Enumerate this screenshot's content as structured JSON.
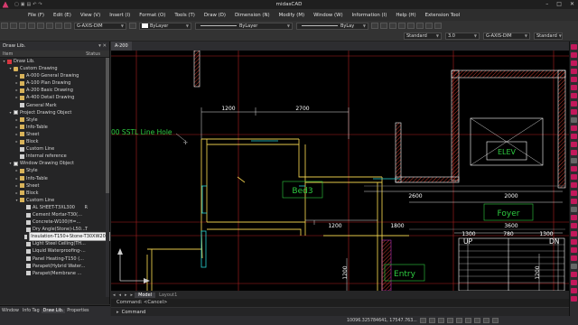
{
  "app": {
    "title": "midasCAD"
  },
  "menu": [
    "File (F)",
    "Edit (E)",
    "View (V)",
    "Insert (I)",
    "Format (O)",
    "Tools (T)",
    "Draw (D)",
    "Dimension (N)",
    "Modify (M)",
    "Window (W)",
    "Information (I)",
    "Help (H)",
    "Extension Tool"
  ],
  "toolbar": {
    "layer": "G-AXIS-DIM",
    "color": "ByLayer",
    "linetype": "ByLayer",
    "lineweight": "ByLay",
    "text_style": "Standard",
    "text_height": "3.0",
    "dim_layer": "G-AXIS-DIM",
    "dim_style": "Standard"
  },
  "left_panel": {
    "title": "Draw Lib.",
    "col_item": "Item",
    "col_status": "Status",
    "tree": [
      {
        "label": "Draw Lib.",
        "depth": 0,
        "icon": "red",
        "exp": "▾"
      },
      {
        "label": "Custom Drawing",
        "depth": 1,
        "icon": "cube",
        "exp": "▾"
      },
      {
        "label": "A-000 General Drawing",
        "depth": 2,
        "icon": "folder",
        "exp": "▸"
      },
      {
        "label": "A-100 Plan Drawing",
        "depth": 2,
        "icon": "folder",
        "exp": "▸"
      },
      {
        "label": "A-200 Basic Drawing",
        "depth": 2,
        "icon": "folder",
        "exp": "▸"
      },
      {
        "label": "A-400 Detail Drawing",
        "depth": 2,
        "icon": "folder",
        "exp": "▸"
      },
      {
        "label": "General Mark",
        "depth": 2,
        "icon": "doc",
        "exp": ""
      },
      {
        "label": "Project Drawing Object",
        "depth": 1,
        "icon": "chk",
        "exp": "▾"
      },
      {
        "label": "Style",
        "depth": 2,
        "icon": "folder",
        "exp": "▸"
      },
      {
        "label": "Info-Table",
        "depth": 2,
        "icon": "folder",
        "exp": "▸"
      },
      {
        "label": "Sheet",
        "depth": 2,
        "icon": "folder",
        "exp": "▸"
      },
      {
        "label": "Block",
        "depth": 2,
        "icon": "folder",
        "exp": "▸"
      },
      {
        "label": "Custom Line",
        "depth": 2,
        "icon": "doc",
        "exp": ""
      },
      {
        "label": "Internal reference",
        "depth": 2,
        "icon": "doc",
        "exp": ""
      },
      {
        "label": "Window Drawing Object",
        "depth": 1,
        "icon": "chk",
        "exp": "▾"
      },
      {
        "label": "Style",
        "depth": 2,
        "icon": "folder",
        "exp": "▸"
      },
      {
        "label": "Info-Table",
        "depth": 2,
        "icon": "folder",
        "exp": "▸"
      },
      {
        "label": "Sheet",
        "depth": 2,
        "icon": "folder",
        "exp": "▸"
      },
      {
        "label": "Block",
        "depth": 2,
        "icon": "folder",
        "exp": "▸"
      },
      {
        "label": "Custom Line",
        "depth": 2,
        "icon": "folder",
        "exp": "▾"
      },
      {
        "label": "AL SHEET-T3XL300",
        "depth": 3,
        "icon": "doc",
        "exp": "",
        "flag": "R"
      },
      {
        "label": "Cement Mortar-T30(...",
        "depth": 3,
        "icon": "doc",
        "exp": ""
      },
      {
        "label": "Concrete-W100(H=...",
        "depth": 3,
        "icon": "doc",
        "exp": ""
      },
      {
        "label": "Dry Angle(Stone)-L50...",
        "depth": 3,
        "icon": "doc",
        "exp": "",
        "flag": "T"
      },
      {
        "label": "Insulation-T150+Stone-T30XW200",
        "depth": 3,
        "icon": "doc",
        "exp": "",
        "selected": true
      },
      {
        "label": "Light Steel Ceiling(TH...",
        "depth": 3,
        "icon": "doc",
        "exp": ""
      },
      {
        "label": "Liquid Waterproofing-...",
        "depth": 3,
        "icon": "doc",
        "exp": ""
      },
      {
        "label": "Panel Heating-T150 (...",
        "depth": 3,
        "icon": "doc",
        "exp": ""
      },
      {
        "label": "Parapet(Hybrid Water...",
        "depth": 3,
        "icon": "doc",
        "exp": ""
      },
      {
        "label": "Parapet(Membrane ...",
        "depth": 3,
        "icon": "doc",
        "exp": ""
      }
    ],
    "bottom_tabs": [
      "Window",
      "Info Tag",
      "Draw Lib.",
      "Properties"
    ]
  },
  "document": {
    "tab": "A-200"
  },
  "canvas": {
    "callout": "00 SSTL Line Hole",
    "rooms": {
      "bed3": "Bed3",
      "elev": "ELEV",
      "foyer": "Foyer",
      "entry": "Entry",
      "up": "UP",
      "dn": "DN"
    },
    "dims": {
      "d1200a": "1200",
      "d2700": "2700",
      "d2600": "2600",
      "d2000": "2000",
      "d3600": "3600",
      "d1200b": "1200",
      "d1800": "1800",
      "d1300a": "1300",
      "d780": "780",
      "d1300b": "1300",
      "d1200v": "1200",
      "d1200v2": "1200"
    }
  },
  "model_tabs": [
    "Model",
    "Layout1"
  ],
  "command": {
    "history": "Command: <Cancel>",
    "prompt": "Command"
  },
  "status": {
    "coords": "10096.325784641, 17547.763..."
  }
}
